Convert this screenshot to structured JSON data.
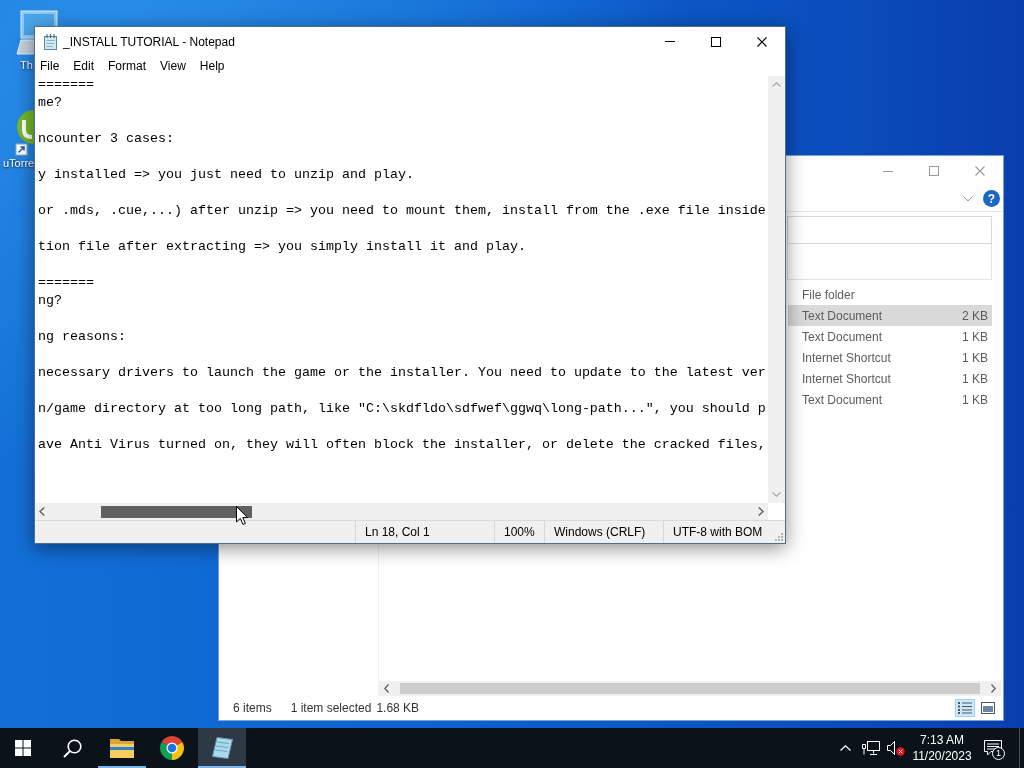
{
  "desktop": {
    "icons": [
      {
        "kind": "computer",
        "label": "Th"
      },
      {
        "kind": "app_shortcut",
        "label": "uTorre"
      }
    ]
  },
  "notepad": {
    "title": "_INSTALL TUTORIAL - Notepad",
    "menu": [
      "File",
      "Edit",
      "Format",
      "View",
      "Help"
    ],
    "paragraphs": [
      [
        "=======",
        "me?"
      ],
      [
        "ncounter 3 cases:"
      ],
      [
        "y installed => you just need to unzip and play."
      ],
      [
        "or .mds, .cue,...) after unzip => you need to mount them, install from the .exe file inside"
      ],
      [
        "tion file after extracting => you simply install it and play."
      ],
      [
        "=======",
        "ng?"
      ],
      [
        "ng reasons:"
      ],
      [
        "necessary drivers to launch the game or the installer. You need to update to the latest ver"
      ],
      [
        "n/game directory at too long path, like \"C:\\skdfldo\\sdfwef\\ggwq\\long-path...\", you should p"
      ],
      [
        "ave Anti Virus turned on, they will often block the installer, or delete the cracked files,"
      ]
    ],
    "status_bar": [
      "Ln 18, Col 1",
      "100%",
      "Windows (CRLF)",
      "UTF-8 with BOM"
    ]
  },
  "file_explorer": {
    "help_button": {
      "label": "?"
    },
    "rows": [
      {
        "type": "File folder",
        "selected": false
      },
      {
        "type": "Text Document",
        "size": "2 KB",
        "selected": true
      },
      {
        "type": "Text Document",
        "size": "1 KB",
        "selected": false
      },
      {
        "type": "Internet Shortcut",
        "size": "1 KB",
        "selected": false
      },
      {
        "type": "Internet Shortcut",
        "size": "1 KB",
        "selected": false
      },
      {
        "type": "Text Document",
        "size": "1 KB",
        "selected": false
      }
    ],
    "status_bar": {
      "item_count": "6 items",
      "selection": "1 item selected",
      "selection_size": "1.68 KB"
    },
    "view_buttons": [
      {
        "kind": "details",
        "selected": true
      },
      {
        "kind": "preview",
        "selected": false
      }
    ]
  },
  "taskbar": {
    "apps": [
      {
        "kind": "start",
        "running": false,
        "active": false
      },
      {
        "kind": "search",
        "running": false,
        "active": false
      },
      {
        "kind": "explorer",
        "running": true,
        "active": false
      },
      {
        "kind": "browser",
        "running": false,
        "active": false
      },
      {
        "kind": "notepad",
        "running": true,
        "active": true
      }
    ],
    "tray": [
      {
        "kind": "overflow"
      },
      {
        "kind": "network"
      },
      {
        "kind": "volume_muted"
      }
    ],
    "clock": {
      "time": "7:13 AM",
      "date": "11/20/2023"
    },
    "notifications": {
      "count": "1"
    }
  }
}
